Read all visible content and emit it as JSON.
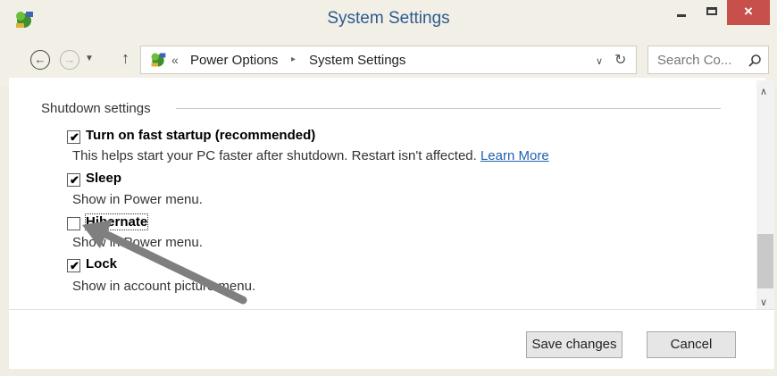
{
  "window": {
    "title": "System Settings",
    "close_glyph": "×"
  },
  "nav": {
    "back_glyph": "←",
    "forward_glyph": "→",
    "recent_glyph": "▼",
    "up_glyph": "↑"
  },
  "address": {
    "chevron": "«",
    "crumbs": [
      "Power Options",
      "System Settings"
    ],
    "separator": "▸",
    "dropdown_glyph": "∨",
    "refresh_glyph": "↻"
  },
  "search": {
    "placeholder": "Search Co..."
  },
  "section": {
    "title": "Shutdown settings",
    "options": [
      {
        "label": "Turn on fast startup (recommended)",
        "checked": true,
        "description": "This helps start your PC faster after shutdown. Restart isn't affected.",
        "link": "Learn More"
      },
      {
        "label": "Sleep",
        "checked": true,
        "description": "Show in Power menu."
      },
      {
        "label": "Hibernate",
        "checked": false,
        "description": "Show in Power menu."
      },
      {
        "label": "Lock",
        "checked": true,
        "description": "Show in account picture menu."
      }
    ]
  },
  "scrollbar": {
    "up_glyph": "∧",
    "down_glyph": "∨"
  },
  "buttons": {
    "save": "Save changes",
    "cancel": "Cancel"
  },
  "check_glyph": "✔",
  "colors": {
    "close_button": "#c7504b",
    "title_text": "#2d5a8f",
    "link": "#1f5fb3",
    "annotation_arrow": "#7f7f7f"
  },
  "icons": [
    "control-panel-icon",
    "search-icon",
    "annotation-arrow"
  ]
}
